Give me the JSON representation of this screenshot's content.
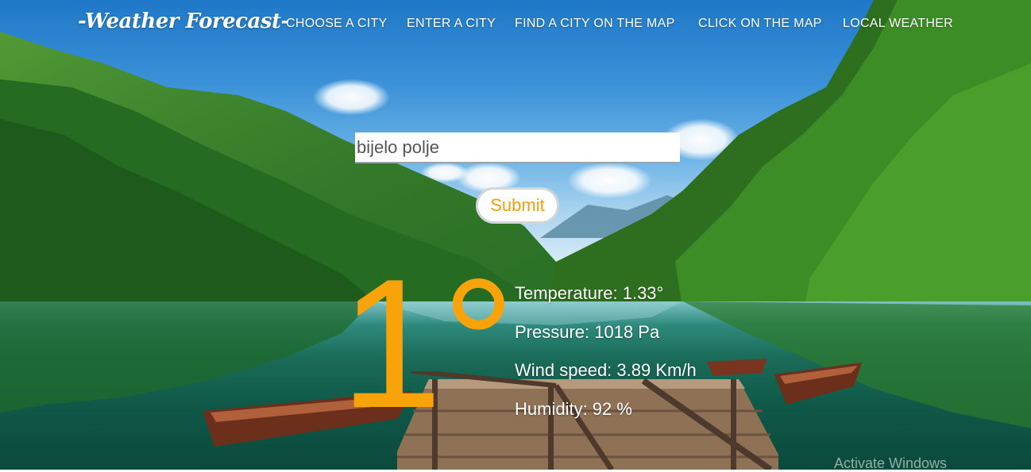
{
  "nav": {
    "brand": "-Weather Forecast-",
    "links": [
      "CHOOSE A CITY",
      "ENTER A CITY",
      "FIND A CITY ON THE MAP",
      "CLICK ON THE MAP",
      "LOCAL WEATHER"
    ]
  },
  "form": {
    "city_value": "bijelo polje",
    "submit_label": "Submit"
  },
  "weather": {
    "big_temp_number": "1",
    "big_temp_degree": "°",
    "temperature": "Temperature: 1.33°",
    "pressure": "Pressure: 1018 Pa",
    "wind_speed": "Wind speed: 3.89 Km/h",
    "humidity": "Humidity: 92 %"
  },
  "overlay": {
    "watermark": "Activate Windows"
  },
  "colors": {
    "accent": "#f9a30a",
    "text": "#ffffff"
  }
}
